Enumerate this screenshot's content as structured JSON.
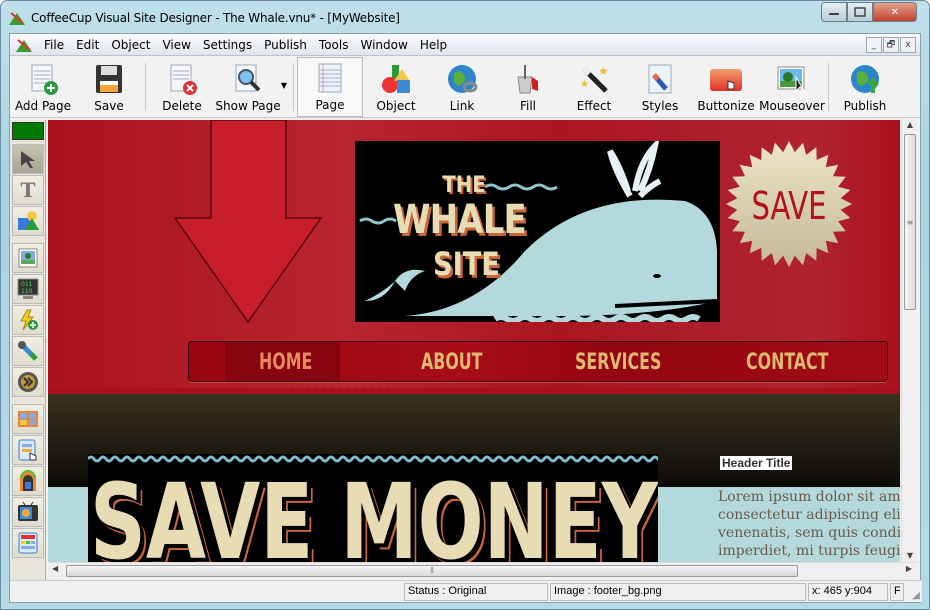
{
  "window": {
    "title": "CoffeeCup Visual Site Designer - The Whale.vnu* - [MyWebsite]",
    "caption_buttons": [
      "minimize",
      "maximize",
      "close"
    ]
  },
  "menubar": {
    "items": [
      "File",
      "Edit",
      "Object",
      "View",
      "Settings",
      "Publish",
      "Tools",
      "Window",
      "Help"
    ],
    "mdi_buttons": [
      "_",
      "🗗",
      "x"
    ]
  },
  "toolbar": {
    "buttons": [
      {
        "label": "Add Page",
        "icon": "add-page-icon"
      },
      {
        "label": "Save",
        "icon": "floppy-disk-icon"
      },
      {
        "label": "Delete",
        "icon": "delete-page-icon"
      },
      {
        "label": "Show Page",
        "icon": "magnifier-page-icon",
        "dropdown": true
      },
      {
        "label": "Page",
        "icon": "page-icon",
        "active": true
      },
      {
        "label": "Object",
        "icon": "shapes-icon"
      },
      {
        "label": "Link",
        "icon": "globe-link-icon"
      },
      {
        "label": "Fill",
        "icon": "paint-bucket-icon"
      },
      {
        "label": "Effect",
        "icon": "magic-wand-icon"
      },
      {
        "label": "Styles",
        "icon": "styles-brush-icon"
      },
      {
        "label": "Buttonize",
        "icon": "buttonize-icon"
      },
      {
        "label": "Mouseover",
        "icon": "mouseover-image-icon"
      },
      {
        "label": "Publish",
        "icon": "globe-upload-icon"
      }
    ]
  },
  "leftbar": {
    "color_swatch": "#007a00",
    "tools": [
      "pointer-arrow",
      "text-tool",
      "shapes-tool",
      "image-tool",
      "html-code-tool",
      "flash-add-tool",
      "color-picker-tool",
      "video-tool",
      "gallery-tool",
      "form-tool",
      "jukebox-tool",
      "media-player-tool",
      "table-tool"
    ]
  },
  "canvas": {
    "logo": {
      "line1": "THE",
      "line2": "WHALE",
      "line3": "SITE"
    },
    "save_badge": "SAVE",
    "nav": [
      "HOME",
      "ABOUT",
      "SERVICES",
      "CONTACT"
    ],
    "headline": "SAVE MONEY",
    "header_title": "Header Title",
    "lorem_lines": [
      "Lorem ipsum dolor sit amet",
      "consectetur adipiscing elit. I",
      "venenatis, sem quis condim",
      "imperdiet, mi turpis feugiat"
    ],
    "colors": {
      "red": "#b01622",
      "dark": "#2b261a",
      "cream": "#e8dcb4",
      "teal": "#b3d9dc",
      "nav_text": "#e0b870",
      "home_text": "#e58a5c"
    }
  },
  "statusbar": {
    "status": "Status : Original",
    "image": "Image : footer_bg.png",
    "coords": "x: 465  y:904",
    "extra": "F"
  }
}
